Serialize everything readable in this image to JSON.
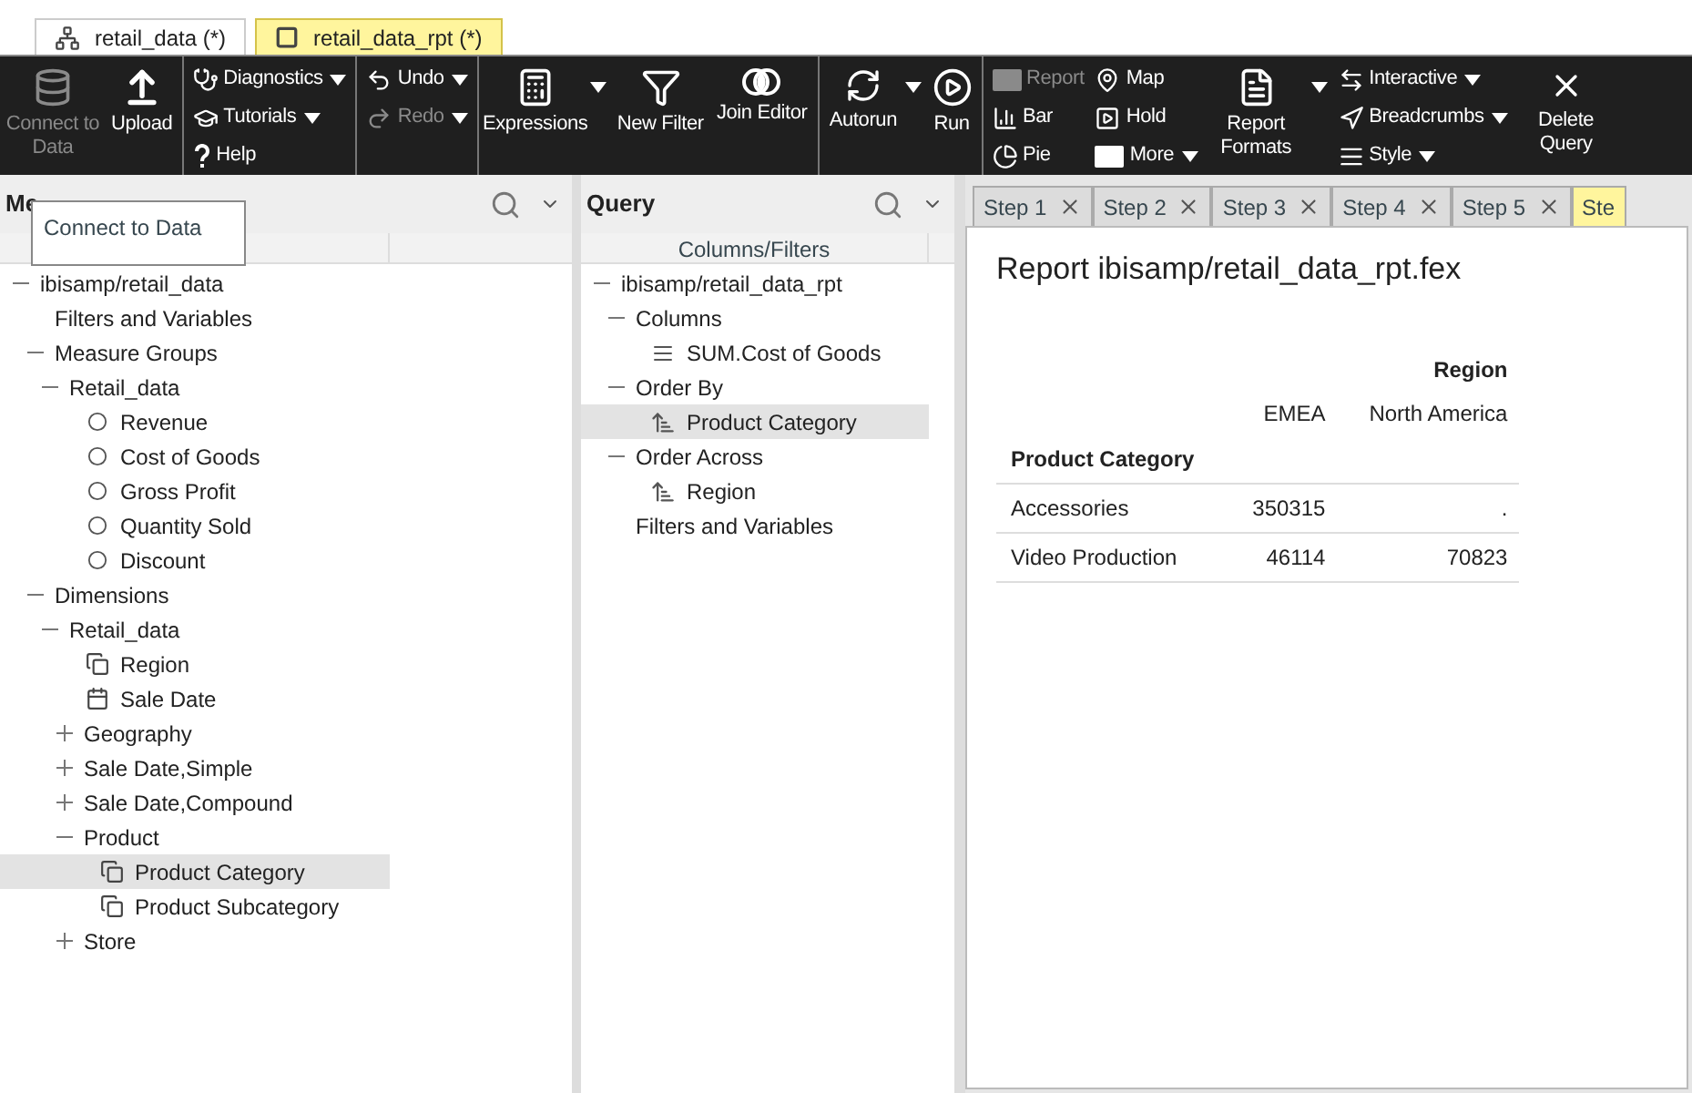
{
  "doc_tabs": [
    {
      "label": "retail_data (*)",
      "selected": false
    },
    {
      "label": "retail_data_rpt (*)",
      "selected": true
    }
  ],
  "toolbar": [
    {
      "kind": "big",
      "label": "Connect to Data",
      "disabled": true,
      "dropdown": false
    },
    {
      "kind": "big",
      "label": "Upload",
      "disabled": false,
      "dropdown": false
    },
    {
      "kind": "stack",
      "items": [
        {
          "label": "Diagnostics",
          "disabled": false,
          "dropdown": true
        },
        {
          "label": "Tutorials",
          "disabled": false,
          "dropdown": true
        },
        {
          "label": "Help",
          "disabled": false,
          "dropdown": false
        }
      ]
    },
    {
      "kind": "stack",
      "items": [
        {
          "label": "Undo",
          "disabled": false,
          "dropdown": true
        },
        {
          "label": "Redo",
          "disabled": true,
          "dropdown": true
        }
      ]
    },
    {
      "kind": "big",
      "label": "Expressions",
      "disabled": false,
      "dropdown": true
    },
    {
      "kind": "big",
      "label": "New Filter",
      "disabled": false,
      "dropdown": false
    },
    {
      "kind": "big",
      "label": "Join Editor",
      "disabled": false,
      "dropdown": false
    },
    {
      "kind": "big",
      "label": "Autorun",
      "disabled": false,
      "dropdown": true
    },
    {
      "kind": "big",
      "label": "Run",
      "disabled": false,
      "dropdown": false
    },
    {
      "kind": "stack",
      "items": [
        {
          "label": "Report",
          "disabled": true,
          "dropdown": false
        },
        {
          "label": "Bar",
          "disabled": false,
          "dropdown": false
        },
        {
          "label": "Pie",
          "disabled": false,
          "dropdown": false
        }
      ]
    },
    {
      "kind": "stack",
      "items": [
        {
          "label": "Map",
          "disabled": false,
          "dropdown": false
        },
        {
          "label": "Hold",
          "disabled": false,
          "dropdown": false
        },
        {
          "label": "More",
          "disabled": false,
          "dropdown": true
        }
      ]
    },
    {
      "kind": "big",
      "label": "Report Formats",
      "disabled": false,
      "dropdown": true
    },
    {
      "kind": "stack",
      "items": [
        {
          "label": "Interactive",
          "disabled": false,
          "dropdown": true
        },
        {
          "label": "Breadcrumbs",
          "disabled": false,
          "dropdown": true
        },
        {
          "label": "Style",
          "disabled": false,
          "dropdown": true
        }
      ]
    },
    {
      "kind": "big",
      "label": "Delete Query",
      "disabled": false,
      "dropdown": false
    }
  ],
  "metadata": {
    "title": "Me",
    "tooltip": "Connect to Data",
    "tree": [
      {
        "label": "ibisamp/retail_data",
        "expanded": true,
        "children": [
          {
            "label": "Filters and Variables"
          },
          {
            "label": "Measure Groups",
            "expanded": true,
            "children": [
              {
                "label": "Retail_data",
                "expanded": true,
                "children": [
                  {
                    "label": "Revenue",
                    "kind": "measure"
                  },
                  {
                    "label": "Cost of Goods",
                    "kind": "measure"
                  },
                  {
                    "label": "Gross Profit",
                    "kind": "measure"
                  },
                  {
                    "label": "Quantity Sold",
                    "kind": "measure"
                  },
                  {
                    "label": "Discount",
                    "kind": "measure"
                  }
                ]
              }
            ]
          },
          {
            "label": "Dimensions",
            "expanded": true,
            "children": [
              {
                "label": "Retail_data",
                "expanded": true,
                "children": [
                  {
                    "label": "Region",
                    "kind": "dimension",
                    "selected": false
                  },
                  {
                    "label": "Sale Date",
                    "kind": "date",
                    "selected": false
                  },
                  {
                    "label": "Geography",
                    "expanded": false
                  },
                  {
                    "label": "Sale Date,Simple",
                    "expanded": false
                  },
                  {
                    "label": "Sale Date,Compound",
                    "expanded": false
                  },
                  {
                    "label": "Product",
                    "expanded": true,
                    "children": [
                      {
                        "label": "Product Category",
                        "kind": "dimension",
                        "selected": true
                      },
                      {
                        "label": "Product Subcategory",
                        "kind": "dimension",
                        "selected": false
                      }
                    ]
                  },
                  {
                    "label": "Store",
                    "expanded": false
                  }
                ]
              }
            ]
          }
        ]
      }
    ]
  },
  "query": {
    "title": "Query",
    "header": "Columns/Filters",
    "tree": [
      {
        "label": "ibisamp/retail_data_rpt",
        "expanded": true,
        "children": [
          {
            "label": "Columns",
            "expanded": true,
            "children": [
              {
                "label": "SUM.Cost of Goods",
                "kind": "column",
                "selected": false
              }
            ]
          },
          {
            "label": "Order By",
            "expanded": true,
            "children": [
              {
                "label": "Product Category",
                "kind": "sort",
                "selected": true
              }
            ]
          },
          {
            "label": "Order Across",
            "expanded": true,
            "children": [
              {
                "label": "Region",
                "kind": "sort",
                "selected": false
              }
            ]
          },
          {
            "label": "Filters and Variables"
          }
        ]
      }
    ]
  },
  "step_tabs": [
    {
      "label": "Step 1",
      "selected": false
    },
    {
      "label": "Step 2",
      "selected": false
    },
    {
      "label": "Step 3",
      "selected": false
    },
    {
      "label": "Step 4",
      "selected": false
    },
    {
      "label": "Step 5",
      "selected": false
    },
    {
      "label": "Ste",
      "selected": true
    }
  ],
  "report": {
    "title": "Report ibisamp/retail_data_rpt.fex",
    "across_label": "Region",
    "across_values": [
      "EMEA",
      "North America"
    ],
    "by_label": "Product Category",
    "rows": [
      {
        "label": "Accessories",
        "values": [
          "350315",
          "."
        ]
      },
      {
        "label": "Video Production",
        "values": [
          "46114",
          "70823"
        ]
      }
    ]
  }
}
